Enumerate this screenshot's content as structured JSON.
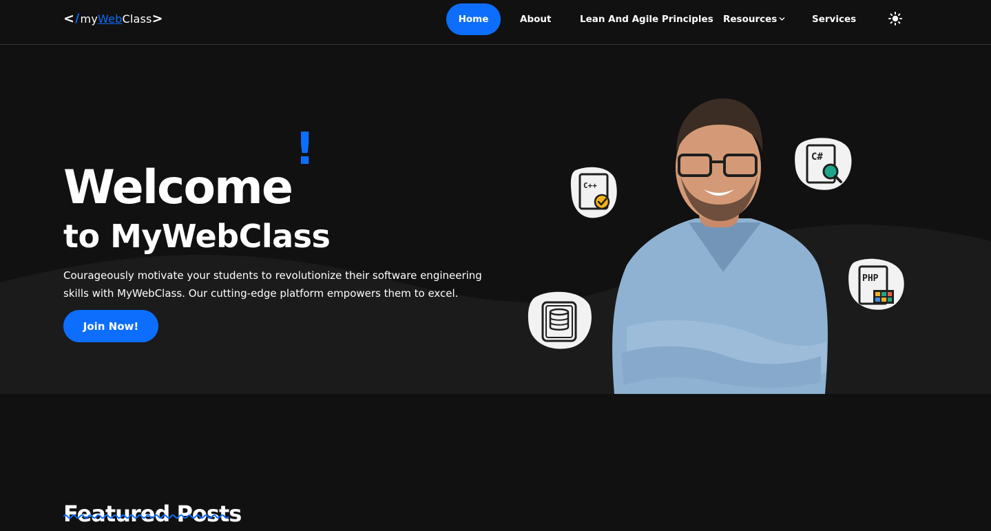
{
  "logo": {
    "open_bracket": "<",
    "slash": "/",
    "part_my": "my",
    "part_web": "Web",
    "part_class": "Class",
    "close_bracket": ">"
  },
  "nav": {
    "items": [
      {
        "label": "Home",
        "active": true
      },
      {
        "label": "About"
      },
      {
        "label": "Lean And Agile Principles"
      },
      {
        "label": "Resources",
        "icon": "chevron-down-icon"
      },
      {
        "label": "Services"
      }
    ],
    "theme_toggle_icon": "sun-icon"
  },
  "hero": {
    "title": "Welcome",
    "title_accent": "!",
    "subtitle": "to MyWebClass",
    "description": "Courageously motivate your students to revolutionize their software engineering skills with MyWebClass. Our cutting-edge platform empowers them to excel.",
    "cta_label": "Join Now!",
    "badges": [
      {
        "icon": "cpp-file-icon",
        "text": "C++"
      },
      {
        "icon": "csharp-search-icon",
        "text": "C#"
      },
      {
        "icon": "php-file-icon",
        "text": "PHP"
      },
      {
        "icon": "database-icon"
      }
    ]
  },
  "featured": {
    "title": "Featured Posts"
  },
  "colors": {
    "accent": "#0d6efd",
    "background": "#111111",
    "hero_wave": "#1b1b1b",
    "text": "#ffffff"
  }
}
